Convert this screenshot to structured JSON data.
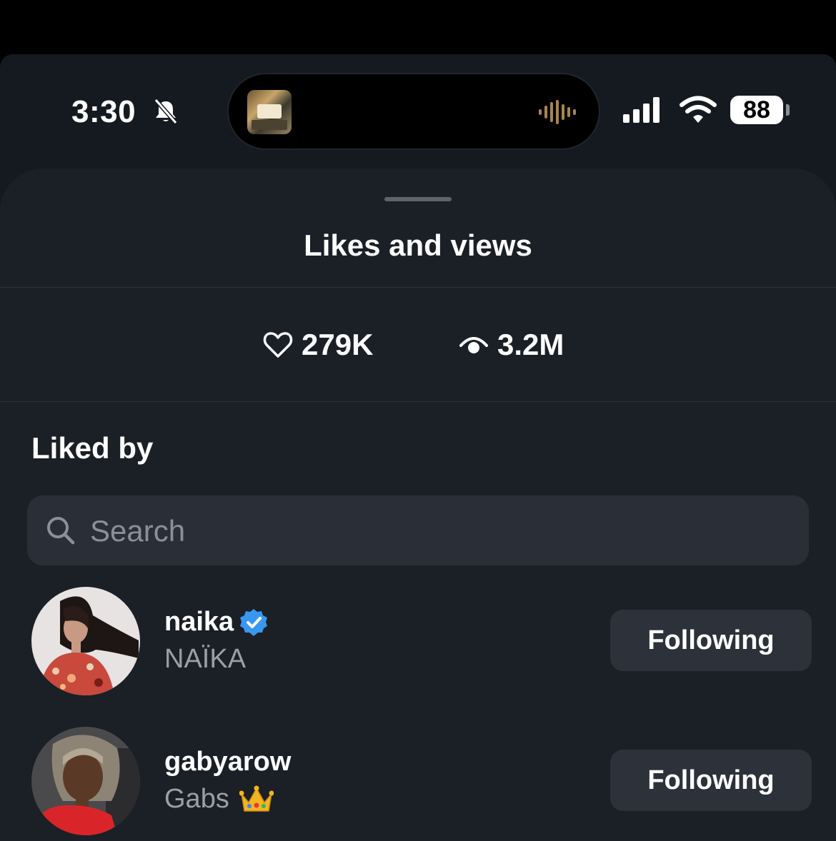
{
  "status_bar": {
    "time": "3:30",
    "battery": "88"
  },
  "sheet": {
    "title": "Likes and views",
    "stats": {
      "likes": "279K",
      "views": "3.2M"
    },
    "section_title": "Liked by",
    "search": {
      "placeholder": "Search"
    },
    "users": [
      {
        "username": "naika",
        "full_name": "NAÏKA",
        "verified": true,
        "button": "Following"
      },
      {
        "username": "gabyarow",
        "full_name": "Gabs",
        "emoji": "👑",
        "button": "Following"
      }
    ]
  }
}
